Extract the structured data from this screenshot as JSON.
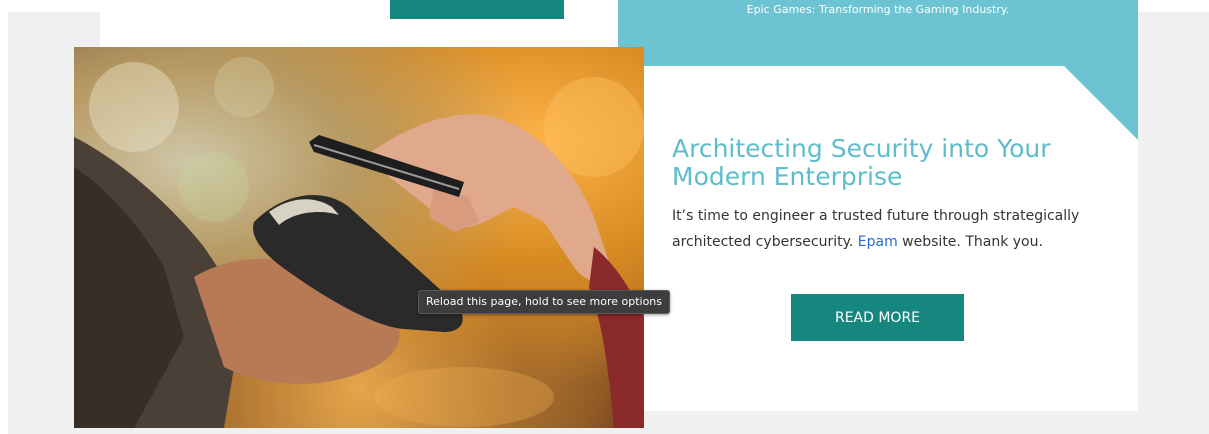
{
  "top_section": {
    "caption": "Epic Games: Transforming the Gaming Industry."
  },
  "article": {
    "title": "Architecting Security into Your Modern Enterprise",
    "body_before_link": "It’s time to engineer a trusted future through strategically architected cybersecurity. ",
    "link_text": "Epam",
    "body_after_link": " website. Thank you.",
    "read_more_label": "READ MORE"
  },
  "image": {
    "subject": "hand holding smartphone over card payment terminal"
  },
  "tooltip": {
    "text": "Reload this page, hold to see more options"
  },
  "colors": {
    "accent_teal": "#16877f",
    "light_teal": "#6cc4d3",
    "title_teal": "#5dbdcc",
    "link_blue": "#2a6acc",
    "page_background": "#f0f0f0"
  }
}
